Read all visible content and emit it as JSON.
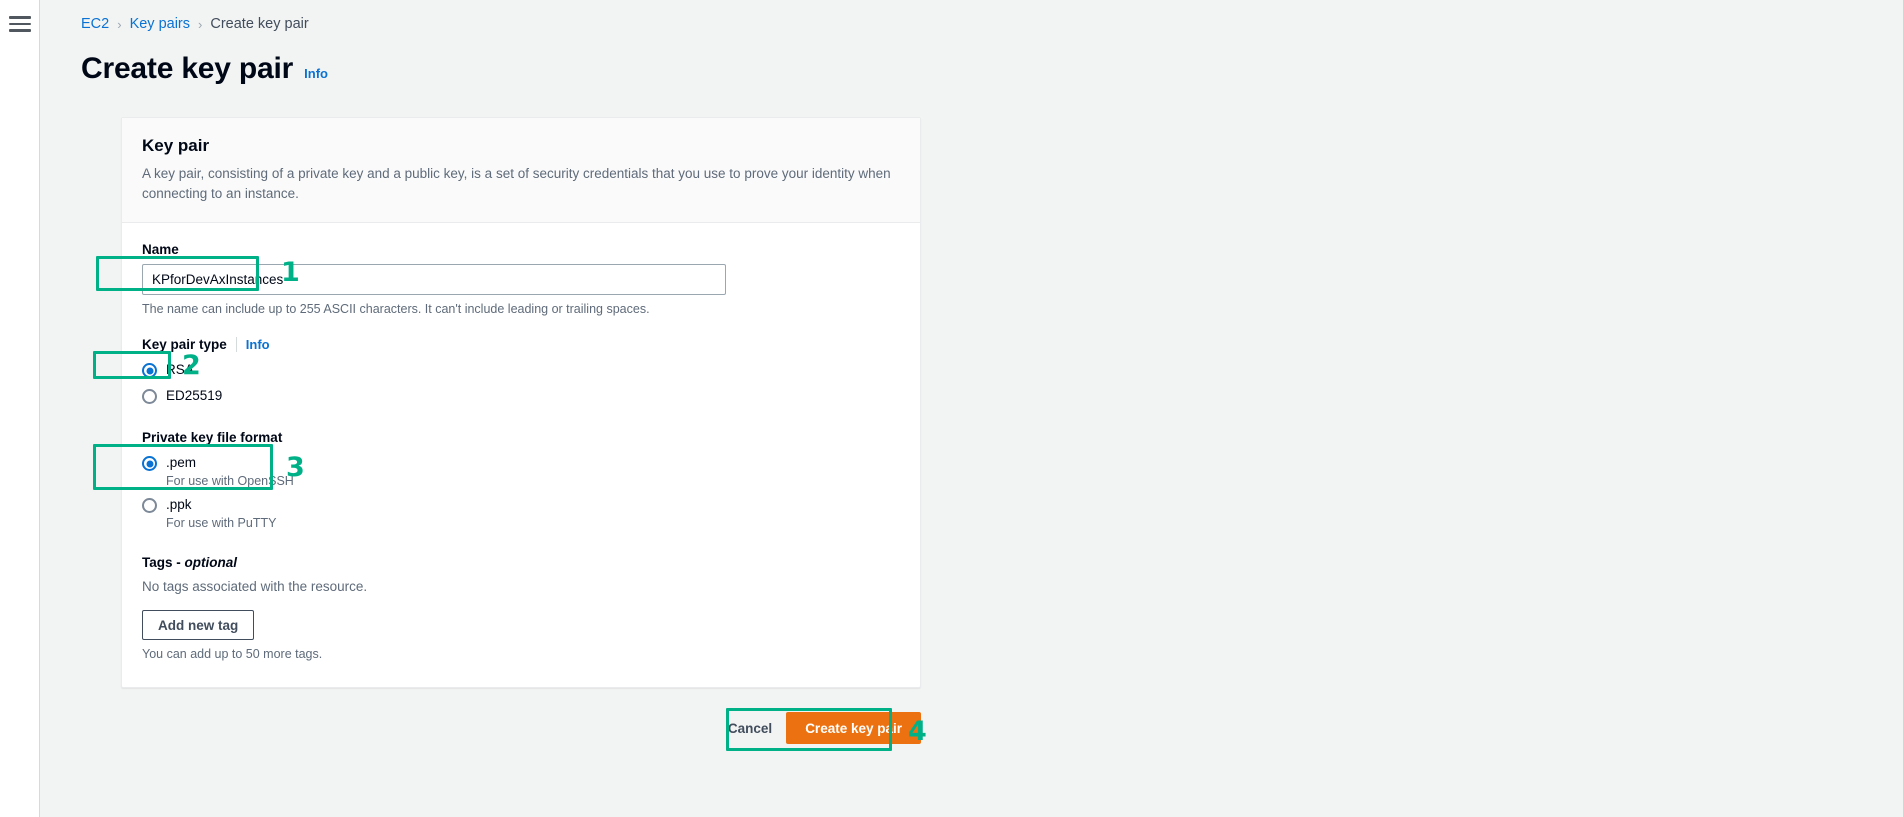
{
  "nav": {
    "menu_icon": "hamburger-menu-icon"
  },
  "breadcrumb": {
    "items": [
      {
        "label": "EC2",
        "type": "link"
      },
      {
        "label": "Key pairs",
        "type": "link"
      },
      {
        "label": "Create key pair",
        "type": "current"
      }
    ],
    "separator": "›"
  },
  "header": {
    "title": "Create key pair",
    "info_label": "Info"
  },
  "card": {
    "title": "Key pair",
    "description": "A key pair, consisting of a private key and a public key, is a set of security credentials that you use to prove your identity when connecting to an instance."
  },
  "name_field": {
    "label": "Name",
    "value": "KPforDevAxInstances",
    "placeholder": "",
    "help": "The name can include up to 255 ASCII characters. It can't include leading or trailing spaces."
  },
  "key_pair_type": {
    "label": "Key pair type",
    "info_label": "Info",
    "options": [
      {
        "label": "RSA",
        "description": "",
        "selected": true
      },
      {
        "label": "ED25519",
        "description": "",
        "selected": false
      }
    ]
  },
  "private_key_format": {
    "label": "Private key file format",
    "options": [
      {
        "label": ".pem",
        "description": "For use with OpenSSH",
        "selected": true
      },
      {
        "label": ".ppk",
        "description": "For use with PuTTY",
        "selected": false
      }
    ]
  },
  "tags": {
    "heading_main": "Tags - ",
    "heading_optional": "optional",
    "empty_text": "No tags associated with the resource.",
    "add_button": "Add new tag",
    "limit_text": "You can add up to 50 more tags."
  },
  "footer": {
    "cancel_label": "Cancel",
    "submit_label": "Create key pair"
  },
  "annotations": {
    "color": "#00b188",
    "steps": [
      {
        "number": "1",
        "target": "name-input"
      },
      {
        "number": "2",
        "target": "rsa-radio"
      },
      {
        "number": "3",
        "target": "pem-radio"
      },
      {
        "number": "4",
        "target": "create-key-pair-button"
      }
    ]
  },
  "colors": {
    "page_background": "#f2f3f3",
    "card_background": "#ffffff",
    "link_blue": "#0972d3",
    "primary_orange": "#ec7211",
    "annotation_green": "#00b188"
  }
}
